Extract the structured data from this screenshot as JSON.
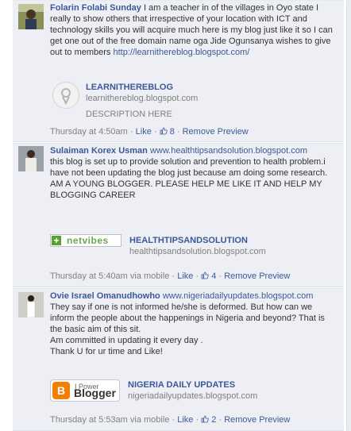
{
  "comments": [
    {
      "author": "Folarin Folabi Sunday",
      "body": "I am a teacher in of the villages in Oyo state I really to show others that irrespective of your location with ICT and technology skills you will acquire much here is my blog just like it so I can get one out of the free domain name oga Jide Ogunsanya wishes to give out to members",
      "body_link": "http://learnithereblog.blogspot.com/",
      "attachment": {
        "title": "LEARNITHEREBLOG",
        "url": "learnithereblog.blogspot.com",
        "description": "DESCRIPTION HERE"
      },
      "meta": {
        "time": "Thursday at 4:50am",
        "like": "Like",
        "likes_count": "8",
        "remove_preview": "Remove Preview"
      }
    },
    {
      "author": "Sulaiman Korex Usman",
      "header_link": "www.healthtipsandsolution.blogspot.com",
      "body_lines": [
        "this blog is set up to provide solution and prevention to health problem.i have not been updating the blog just because am doing some research.",
        "AM A YOUNG BLOGGER. PLEASE HELP ME LIKE IT AND HELP MY BLOGGING CAREER"
      ],
      "badge_text": "netvibes",
      "attachment": {
        "title": "HEALTHTIPSANDSOLUTION",
        "url": "healthtipsandsolution.blogspot.com"
      },
      "meta": {
        "time": "Thursday at 5:40am via mobile",
        "like": "Like",
        "likes_count": "4",
        "remove_preview": "Remove Preview"
      }
    },
    {
      "author": "Ovie Israel Omanudhowho",
      "header_link": "www.nigeriadailyupdates.blogspot.com",
      "body_lines": [
        "They say if one is not informed he/she is deformed. But how can we inform the people about the happenings in Nigeria and beyond? That is the basic aim of this sit.",
        "Am committed in updating it every day .",
        "Thank U for ur time and Like!"
      ],
      "badge": {
        "top": "I Power",
        "word": "Blogger",
        "logo_letter": "B"
      },
      "attachment": {
        "title": "NIGERIA DAILY UPDATES",
        "url": "nigeriadailyupdates.blogspot.com"
      },
      "meta": {
        "time": "Thursday at 5:53am via mobile",
        "like": "Like",
        "likes_count": "2",
        "remove_preview": "Remove Preview"
      }
    }
  ],
  "separator": "·",
  "colors": {
    "link": "#3b5998",
    "background": "#edeff4",
    "meta": "#808080"
  }
}
